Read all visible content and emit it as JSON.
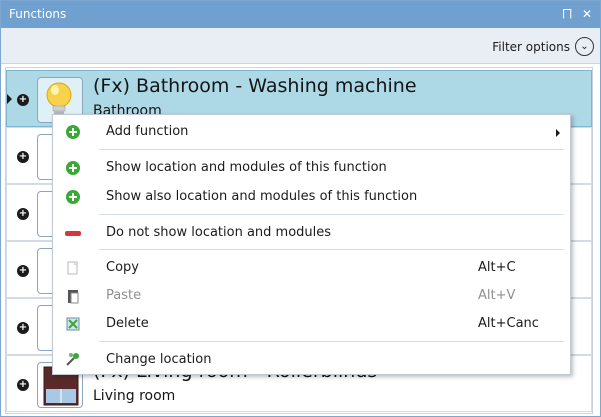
{
  "window": {
    "title": "Functions",
    "pin_glyph": "⨅",
    "close_glyph": "✕"
  },
  "filter": {
    "label": "Filter options",
    "icon": "chevron-down-icon",
    "glyph": "⌄"
  },
  "list": {
    "rows": [
      {
        "name": "(Fx) Bathroom - Washing machine",
        "location": "Bathroom",
        "selected": true,
        "icon": "lightbulb-icon"
      },
      {
        "name": "",
        "location": "",
        "selected": false,
        "icon": "function-icon"
      },
      {
        "name": "",
        "location": "",
        "selected": false,
        "icon": "function-icon"
      },
      {
        "name": "",
        "location": "",
        "selected": false,
        "icon": "function-icon"
      },
      {
        "name": "",
        "location": "",
        "selected": false,
        "icon": "function-icon"
      },
      {
        "name": "(Fx) Living room - Rollerblinds",
        "location": "Living room",
        "selected": false,
        "icon": "rollerblind-icon"
      }
    ]
  },
  "context_menu": {
    "items": [
      {
        "id": "add-function",
        "label": "Add function",
        "shortcut": "",
        "icon": "plus-icon",
        "submenu": true,
        "enabled": true
      },
      {
        "id": "show-location",
        "label": "Show location and modules of this function",
        "shortcut": "",
        "icon": "plus-icon",
        "submenu": false,
        "enabled": true
      },
      {
        "id": "show-also-location",
        "label": "Show also location and modules of this function",
        "shortcut": "",
        "icon": "plus-icon",
        "submenu": false,
        "enabled": true
      },
      {
        "id": "do-not-show",
        "label": "Do not show location and modules",
        "shortcut": "",
        "icon": "minus-icon",
        "submenu": false,
        "enabled": true
      },
      {
        "id": "copy",
        "label": "Copy",
        "shortcut": "Alt+C",
        "icon": "copy-icon",
        "submenu": false,
        "enabled": true
      },
      {
        "id": "paste",
        "label": "Paste",
        "shortcut": "Alt+V",
        "icon": "paste-icon",
        "submenu": false,
        "enabled": false
      },
      {
        "id": "delete",
        "label": "Delete",
        "shortcut": "Alt+Canc",
        "icon": "delete-icon",
        "submenu": false,
        "enabled": true
      },
      {
        "id": "change-location",
        "label": "Change location",
        "shortcut": "",
        "icon": "change-location-icon",
        "submenu": false,
        "enabled": true
      }
    ]
  },
  "colors": {
    "titlebar": "#6fa0cf",
    "selected_row": "#add8e6",
    "plus_green": "#3aa835",
    "minus_red": "#d8363f"
  }
}
